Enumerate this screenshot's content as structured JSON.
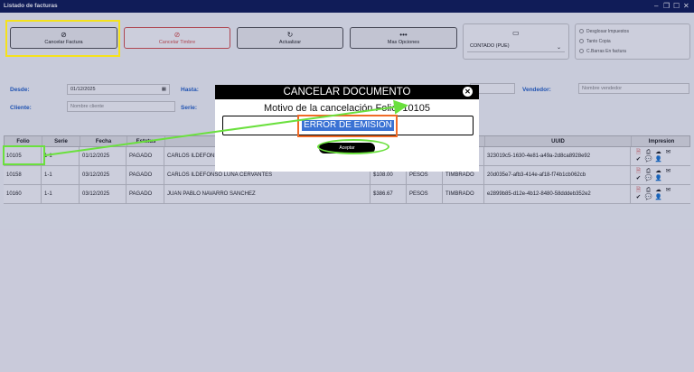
{
  "window": {
    "title": "Listado de facturas",
    "controls": [
      "–",
      "❐",
      "☐",
      "✕"
    ]
  },
  "toolbar": {
    "cancel_invoice": "Cancelar Factura",
    "cancel_stamp": "Cancelar Timbre",
    "refresh": "Actualizar",
    "more_options": "Mas Opciones"
  },
  "payment": {
    "selected": "CONTADO (PUE)"
  },
  "options": {
    "breakdown_taxes": "Desglosar Impuestos",
    "both_copies": "Tanto Copia",
    "barcode": "C.Barras En factura"
  },
  "filters": {
    "from_label": "Desde:",
    "from_value": "01/12/2025",
    "to_label": "Hasta:",
    "seller_label": "Vendedor:",
    "seller_placeholder": "Nombre vendedor",
    "client_label": "Cliente:",
    "client_placeholder": "Nombre cliente",
    "series_label": "Serie:"
  },
  "table": {
    "headers": [
      "Folio",
      "Serie",
      "Fecha",
      "Estatus",
      "UUID",
      "Impresion"
    ],
    "rows": [
      {
        "folio": "10105",
        "serie": "1-1",
        "fecha": "01/12/2025",
        "estatus": "PAGADO",
        "cliente": "CARLOS ILDEFONSO",
        "total": "",
        "moneda": "",
        "timbrado": "",
        "uuid": "323019c5-1630-4e81-a49a-2d8ca8928e92"
      },
      {
        "folio": "10158",
        "serie": "1-1",
        "fecha": "03/12/2025",
        "estatus": "PAGADO",
        "cliente": "CARLOS ILDEFONSO LUNA CERVANTES",
        "total": "$108.00",
        "moneda": "PESOS",
        "timbrado": "TIMBRADO",
        "uuid": "20d035e7-afb3-414e-af18-f74b1cb062cb"
      },
      {
        "folio": "10160",
        "serie": "1-1",
        "fecha": "03/12/2025",
        "estatus": "PAGADO",
        "cliente": "JUAN PABLO NAVARRO SANCHEZ",
        "total": "$386.67",
        "moneda": "PESOS",
        "timbrado": "TIMBRADO",
        "uuid": "e2899b85-d12e-4b12-8480-58dddeb352e2"
      }
    ]
  },
  "modal": {
    "title": "CANCELAR DOCUMENTO",
    "motivo": "Motivo de la cancelación Folio: 10105",
    "reason_value": "ERROR DE EMISIÓN",
    "accept": "Aceptar",
    "close": "✕"
  },
  "icons": {
    "cancel": "⊘",
    "refresh": "↻",
    "more": "•••",
    "card": "▭",
    "chevron": "⌄",
    "pdf": "🗎",
    "print": "⎙",
    "cloud": "☁",
    "mail": "✉",
    "check": "✔",
    "chat": "💬",
    "user": "👤",
    "calendar": "▦"
  }
}
